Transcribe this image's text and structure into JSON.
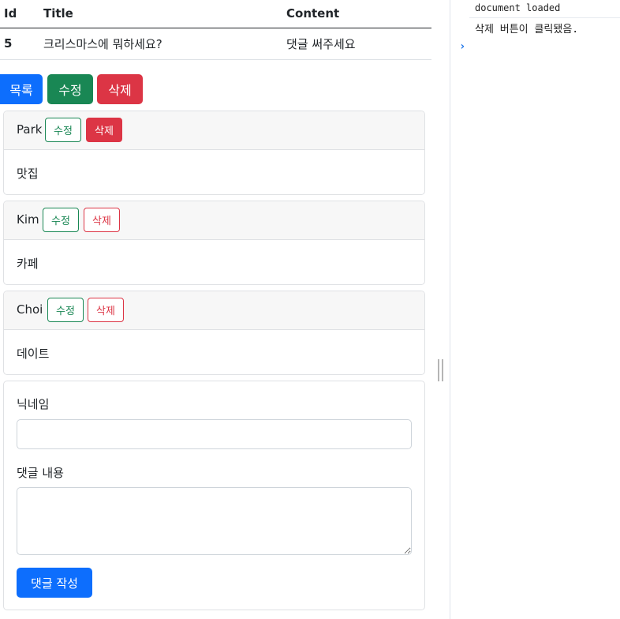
{
  "post_table": {
    "headers": {
      "id": "Id",
      "title": "Title",
      "content": "Content"
    },
    "row": {
      "id": "5",
      "title": "크리스마스에 뭐하세요?",
      "content": "댓글 써주세요"
    }
  },
  "actions": {
    "list": "목록",
    "edit": "수정",
    "delete": "삭제"
  },
  "comments": [
    {
      "nickname": "Park",
      "edit_label": "수정",
      "delete_label": "삭제",
      "body": "맛집"
    },
    {
      "nickname": "Kim",
      "edit_label": "수정",
      "delete_label": "삭제",
      "body": "카페"
    },
    {
      "nickname": "Choi",
      "edit_label": "수정",
      "delete_label": "삭제",
      "body": "데이트"
    }
  ],
  "comment_form": {
    "nickname_label": "닉네임",
    "nickname_value": "",
    "content_label": "댓글 내용",
    "content_value": "",
    "submit_label": "댓글 작성"
  },
  "console": {
    "messages": [
      "document loaded",
      "삭제 버튼이 클릭됐음."
    ],
    "prompt": "›"
  },
  "colors": {
    "primary": "#0d6efd",
    "success": "#198754",
    "danger": "#dc3545",
    "console_prompt": "#1a73e8"
  }
}
